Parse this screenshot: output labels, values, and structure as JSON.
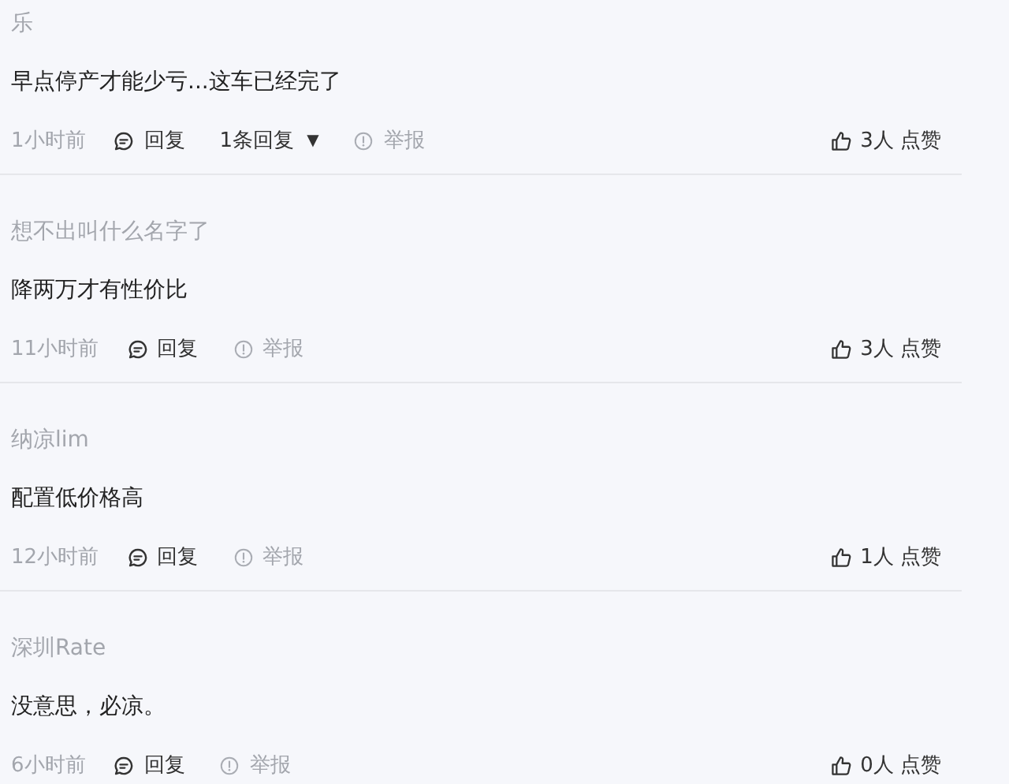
{
  "comments": [
    {
      "user": "乐",
      "text": "早点停产才能少亏...这车已经完了",
      "time": "1小时前",
      "reply": "回复",
      "reply_count": "1条回复",
      "caret": "▼",
      "report": "举报",
      "likes": "3人 点赞"
    },
    {
      "user": "想不出叫什么名字了",
      "text": "降两万才有性价比",
      "time": "11小时前",
      "reply": "回复",
      "report": "举报",
      "likes": "3人 点赞"
    },
    {
      "user": "纳凉lim",
      "text": "配置低价格高",
      "time": "12小时前",
      "reply": "回复",
      "report": "举报",
      "likes": "1人 点赞"
    },
    {
      "user": "深圳Rate",
      "text": "没意思，必凉。",
      "time": "6小时前",
      "reply": "回复",
      "report": "举报",
      "likes": "0人 点赞"
    }
  ]
}
